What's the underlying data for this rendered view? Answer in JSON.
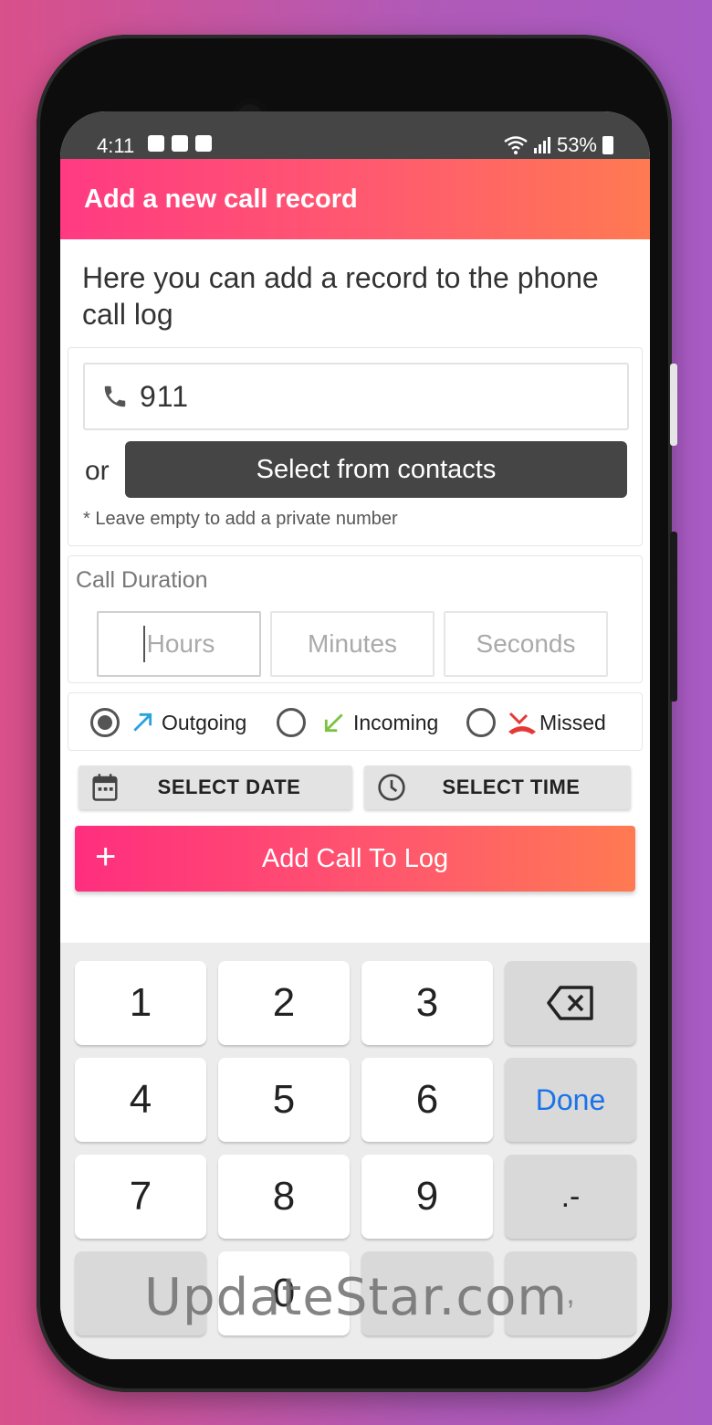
{
  "status_bar": {
    "time": "4:11",
    "battery": "53%"
  },
  "app_bar": {
    "title": "Add a new call record"
  },
  "intro": {
    "text": "Here you can add a record to the phone call log"
  },
  "number": {
    "value": "911",
    "or_label": "or",
    "contacts_button": "Select from contacts",
    "hint": "* Leave empty to add a private number"
  },
  "duration": {
    "label": "Call Duration",
    "hours_placeholder": "Hours",
    "minutes_placeholder": "Minutes",
    "seconds_placeholder": "Seconds"
  },
  "call_type": {
    "selected": "Outgoing",
    "options": [
      {
        "label": "Outgoing",
        "color": "#29a3e0"
      },
      {
        "label": "Incoming",
        "color": "#7cc242"
      },
      {
        "label": "Missed",
        "color": "#e53935"
      }
    ]
  },
  "buttons": {
    "select_date": "SELECT DATE",
    "select_time": "SELECT TIME",
    "add_call": "Add Call To Log"
  },
  "keyboard": {
    "keys": [
      "1",
      "2",
      "3",
      "4",
      "5",
      "6",
      "7",
      "8",
      "9",
      "0"
    ],
    "done": "Done",
    "punct": ".-",
    "comma": ","
  },
  "watermark": "UpdateStar.com",
  "colors": {
    "accent_start": "#ff2e7e",
    "accent_end": "#ff7a52",
    "done_blue": "#1a73e8"
  }
}
